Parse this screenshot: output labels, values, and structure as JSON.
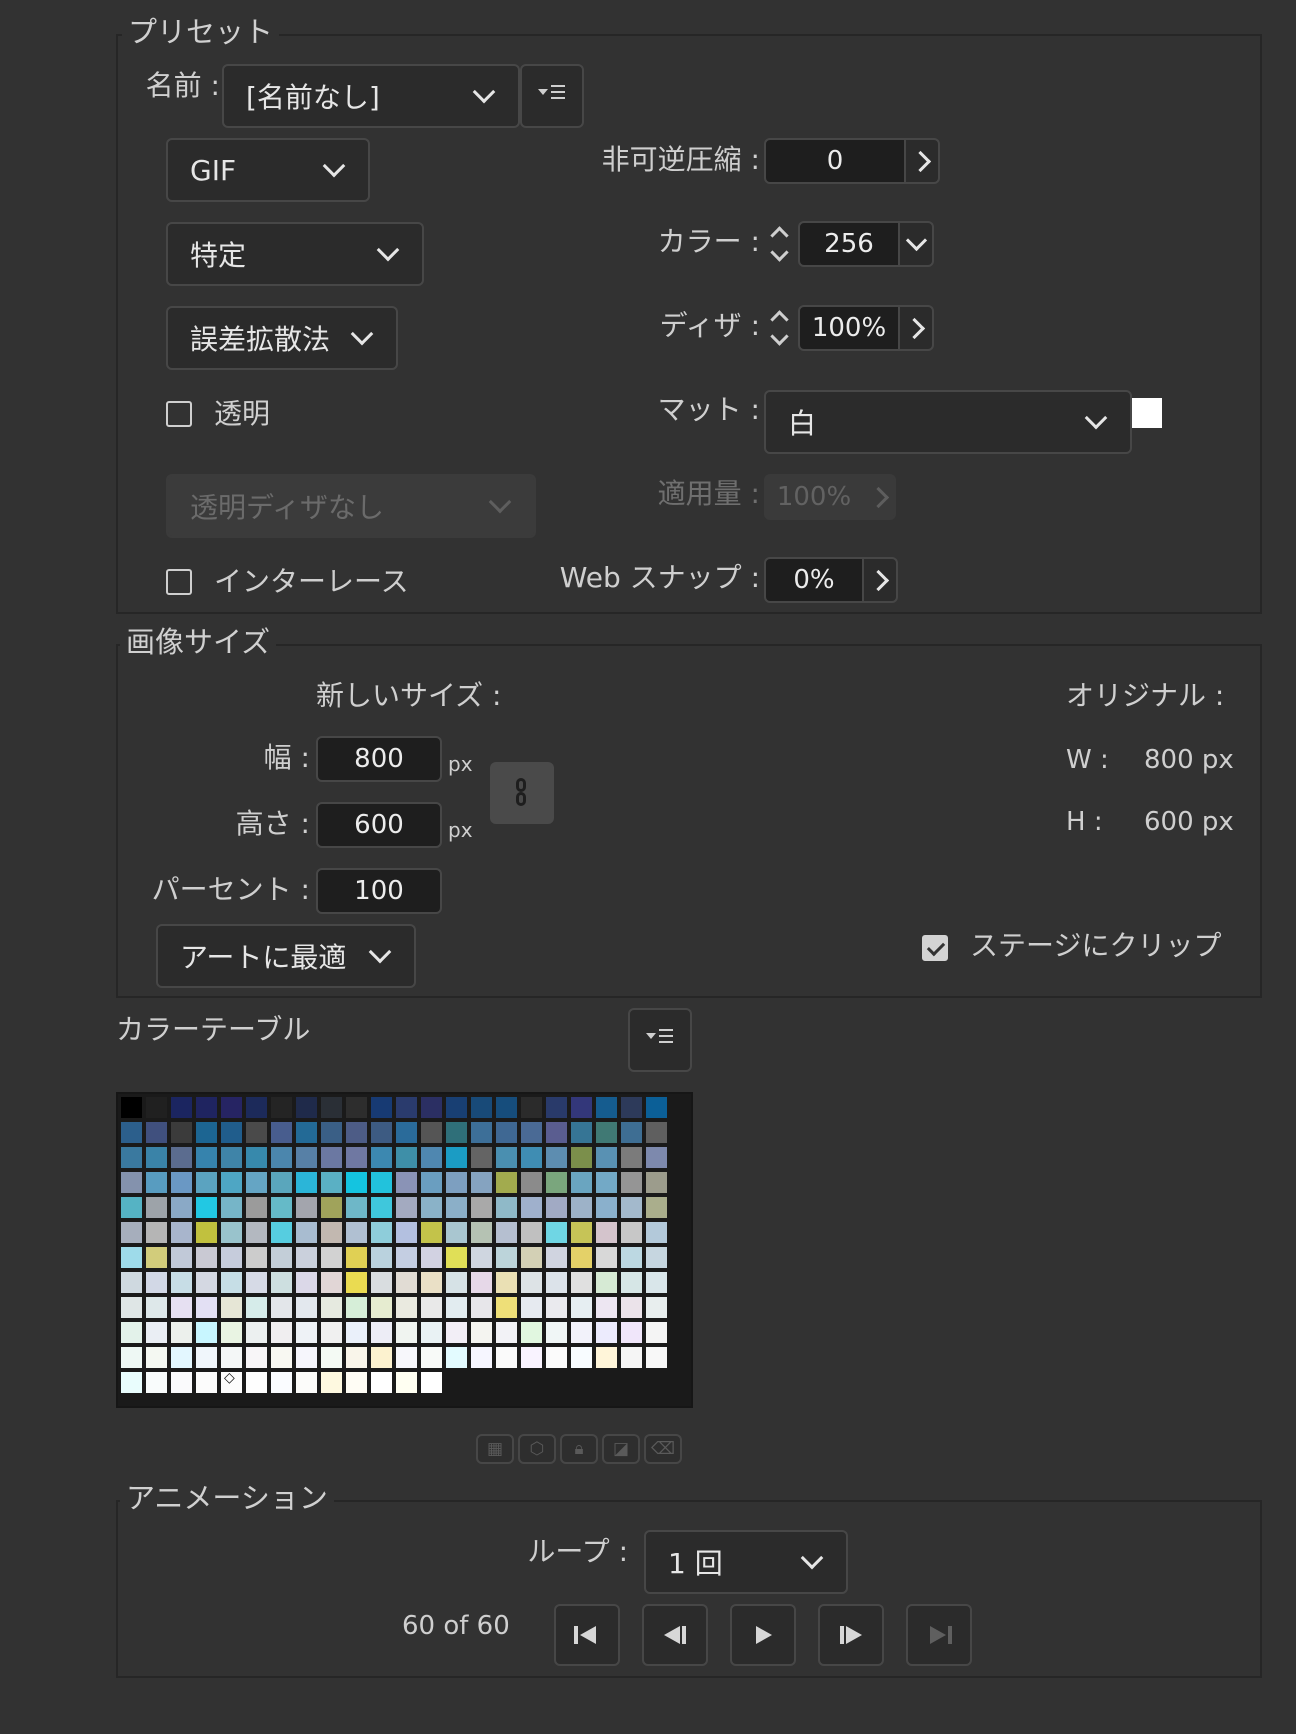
{
  "preset": {
    "title": "プリセット",
    "name_label": "名前 :",
    "name_value": "[名前なし]",
    "format_value": "GIF",
    "palette_value": "特定",
    "dither_method_value": "誤差拡散法",
    "transparency_label": "透明",
    "transparency_checked": false,
    "transparency_dither_value": "透明ディザなし",
    "interlace_label": "インターレース",
    "interlace_checked": false,
    "lossy_label": "非可逆圧縮 :",
    "lossy_value": "0",
    "colors_label": "カラー :",
    "colors_value": "256",
    "dither_label": "ディザ :",
    "dither_value": "100%",
    "matte_label": "マット :",
    "matte_value": "白",
    "matte_color": "#ffffff",
    "amount_label": "適用量 :",
    "amount_value": "100%",
    "websnap_label": "Web スナップ :",
    "websnap_value": "0%"
  },
  "image_size": {
    "title": "画像サイズ",
    "new_size_label": "新しいサイズ :",
    "width_label": "幅 :",
    "width_value": "800",
    "height_label": "高さ :",
    "height_value": "600",
    "percent_label": "パーセント :",
    "percent_value": "100",
    "unit": "px",
    "fit_value": "アートに最適",
    "original_label": "オリジナル :",
    "orig_w_label": "W :",
    "orig_w_value": "800 px",
    "orig_h_label": "H :",
    "orig_h_value": "600 px",
    "clip_label": "ステージにクリップ",
    "clip_checked": true
  },
  "color_table": {
    "title": "カラーテーブル",
    "swatches": [
      "#000000",
      "#202020",
      "#1b2560",
      "#1f2460",
      "#262463",
      "#1c2a5a",
      "#242424",
      "#1f2a4a",
      "#2a2f36",
      "#2d2d2d",
      "#173a73",
      "#2a3b6d",
      "#2b2f63",
      "#183f73",
      "#184a78",
      "#164d7c",
      "#2b2b2b",
      "#293a6a",
      "#33377a",
      "#155c8f",
      "#2d3a5a",
      "#0b5f97",
      "#2c5f8c",
      "#40507e",
      "#3b3b3b",
      "#1c6592",
      "#205d8c",
      "#4a4a4a",
      "#485d8e",
      "#236a96",
      "#3a5f86",
      "#4d5c86",
      "#3d5b82",
      "#2a6b9a",
      "#555555",
      "#2f6f79",
      "#3d6f98",
      "#3f6893",
      "#4a6a95",
      "#5a5d90",
      "#367595",
      "#407974",
      "#3e6e93",
      "#5f5f5f",
      "#3a799f",
      "#3a83a8",
      "#5b6c8f",
      "#3683ad",
      "#3f84a8",
      "#3789ac",
      "#4b86ad",
      "#5780a6",
      "#6b78a2",
      "#6f78a2",
      "#3c88b0",
      "#3e8fa8",
      "#4f87b0",
      "#1b9cc4",
      "#646464",
      "#4a8fb0",
      "#3f8db3",
      "#5d8db0",
      "#7b8f4b",
      "#5991b3",
      "#7b7b7b",
      "#7d89ad",
      "#8492ad",
      "#589cc0",
      "#6a98c4",
      "#5ba3c0",
      "#4ea6c4",
      "#65a5c4",
      "#5aa6bc",
      "#2bb5d8",
      "#5ab0c4",
      "#14c4e0",
      "#22c2dc",
      "#8a93b6",
      "#6a9ec0",
      "#7d9fc0",
      "#85a3c0",
      "#a2ab4e",
      "#8b8b8b",
      "#7aa67d",
      "#6aa5c0",
      "#73a9c6",
      "#959595",
      "#9c9c8c",
      "#55b3c4",
      "#9da3a9",
      "#8aa9c6",
      "#22c8e3",
      "#76b5c8",
      "#9b9b9b",
      "#65bac8",
      "#a3a5ad",
      "#a0a35b",
      "#6eb7c8",
      "#3fc7dc",
      "#a3aac0",
      "#8ab2c8",
      "#8bafc8",
      "#a9a9a9",
      "#8fb9c8",
      "#9fb0cc",
      "#a1aac4",
      "#9db2c8",
      "#8ab0cc",
      "#a3b9cc",
      "#aaae8c",
      "#a6aebc",
      "#b5b5b5",
      "#a8b5cc",
      "#c1c13e",
      "#99c3cc",
      "#b3b8c0",
      "#56cde0",
      "#a8bcd0",
      "#c2b8b0",
      "#b0c0d2",
      "#8ecdda",
      "#b3c0e0",
      "#c3c34a",
      "#a9c6d0",
      "#b5c2b3",
      "#b5bfd0",
      "#c0c0c0",
      "#6fd6e4",
      "#c6c457",
      "#d4c4cc",
      "#c7c7c7",
      "#b3c9da",
      "#9edbea",
      "#d2cc7b",
      "#c1c9d8",
      "#c9c9d3",
      "#c6ccdc",
      "#cccccc",
      "#c3ced8",
      "#cad0dc",
      "#d2d2d2",
      "#e0d054",
      "#bad2de",
      "#c4cee2",
      "#d2d2e2",
      "#e0df57",
      "#cfd6e0",
      "#bcd4da",
      "#d3d0b5",
      "#d0d4e0",
      "#e4d168",
      "#d8d8d8",
      "#bcd8e2",
      "#c6d6e0",
      "#cfd9e0",
      "#d2d8e6",
      "#c7dde6",
      "#d4d8e2",
      "#c6dee6",
      "#d6dae6",
      "#cddfe0",
      "#dbd8e8",
      "#e1d6d6",
      "#eadb51",
      "#d9dde0",
      "#e1dcd4",
      "#eae0c6",
      "#d6e2e6",
      "#e6d8e8",
      "#eae0b4",
      "#dde3e6",
      "#dce3ea",
      "#e0e0e0",
      "#d6ead4",
      "#d6e6e6",
      "#d9e6ea",
      "#dfe6e6",
      "#dee8ea",
      "#e6e0f2",
      "#e3e0f4",
      "#e6e6d6",
      "#d6ecea",
      "#e3e6ea",
      "#e3e8ee",
      "#e6eae0",
      "#d6eed8",
      "#e6ecd0",
      "#eaeae0",
      "#e9e9e9",
      "#e2ecf0",
      "#e7e6ea",
      "#eedf78",
      "#e6eaf0",
      "#eaeaee",
      "#e6eef2",
      "#ede6f2",
      "#ebe3ea",
      "#e8eeee",
      "#e3f2ea",
      "#eaeef4",
      "#ecf0ec",
      "#c8f6ff",
      "#e9f4e3",
      "#ecf0f0",
      "#f0eef0",
      "#eef2f6",
      "#f0f0f0",
      "#eaf0fa",
      "#ededf6",
      "#f0f4f0",
      "#e9f2f4",
      "#f2eef6",
      "#f4f4f0",
      "#f2f2f6",
      "#e1f7e0",
      "#f0f6f6",
      "#f2f2fa",
      "#ecebfd",
      "#f0e6fa",
      "#f4f4f4",
      "#eef8f4",
      "#f4f8f2",
      "#e3f7ff",
      "#f0f6fb",
      "#f4f7f7",
      "#f8f6f8",
      "#f8f8f2",
      "#f6f6fc",
      "#f4faf4",
      "#f9f5ea",
      "#fcf2cf",
      "#f7f7fb",
      "#f8faf8",
      "#e3fbff",
      "#f6f6ff",
      "#fafafa",
      "#f9f3ff",
      "#fbfbfb",
      "#f8fcff",
      "#fff5d9",
      "#f5f5f5",
      "#f8f8f8",
      "#e9fdfd",
      "#f9fcfc",
      "#fafafc",
      "#fcfcfc",
      "#fdfdfd",
      "#fefefe",
      "#fafcff",
      "#fcfcfa",
      "#fef9e0",
      "#fffdf5",
      "#ffffff",
      "#fffff2",
      "#ffffff"
    ],
    "selected_index": 246
  },
  "animation": {
    "title": "アニメーション",
    "loop_label": "ループ :",
    "loop_value": "1 回",
    "frame_status": "60 of 60"
  }
}
